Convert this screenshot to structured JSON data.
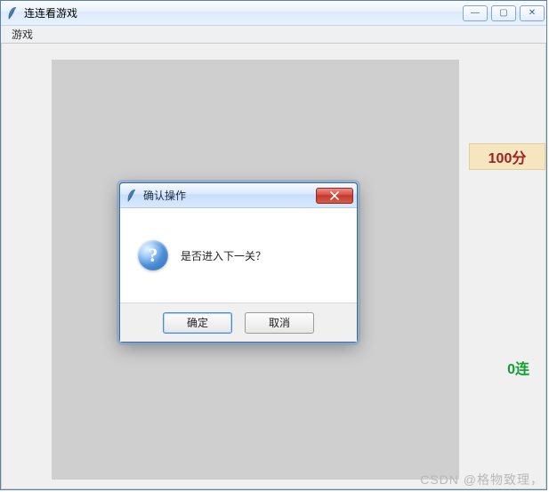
{
  "window": {
    "title": "连连看游戏",
    "menu": {
      "game_label": "游戏"
    },
    "controls": {
      "min": "—",
      "max": "▢",
      "close": "✕"
    }
  },
  "game": {
    "score_text": "100分",
    "combo_text": "0连"
  },
  "dialog": {
    "title": "确认操作",
    "message": "是否进入下一关？",
    "ok_label": "确定",
    "cancel_label": "取消"
  },
  "watermark": "CSDN @格物致理，"
}
